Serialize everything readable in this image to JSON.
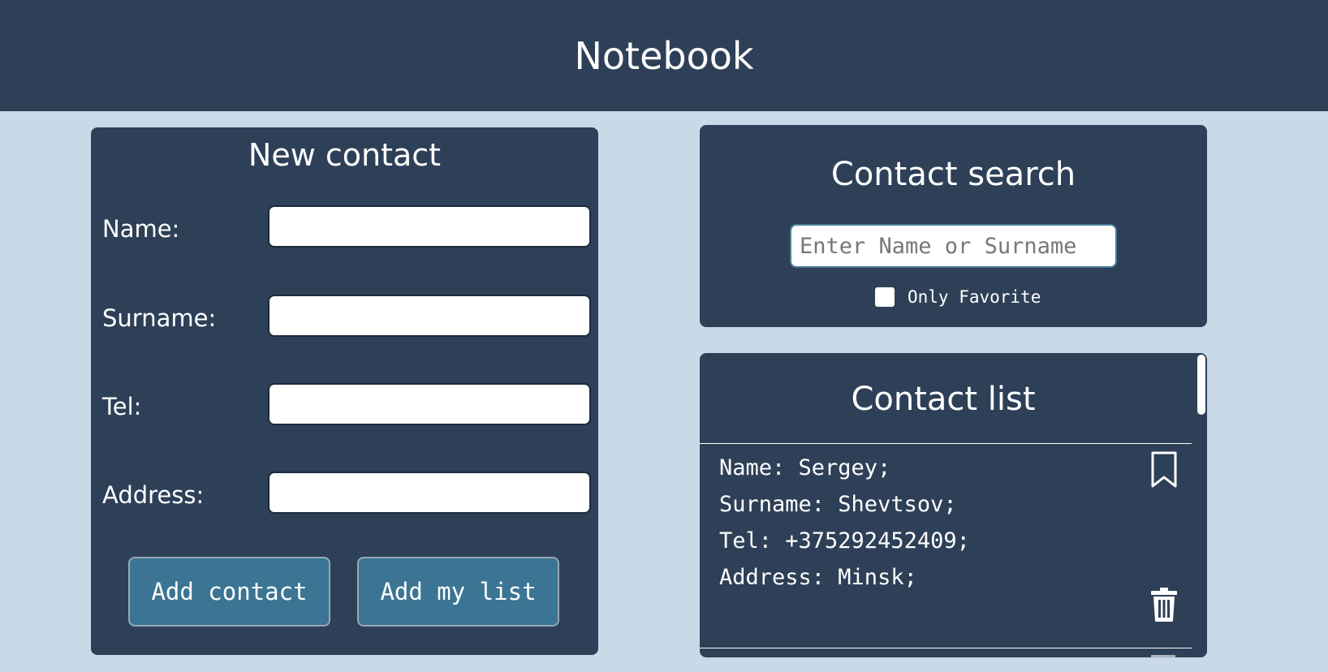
{
  "app": {
    "title": "Notebook"
  },
  "new_contact": {
    "title": "New contact",
    "fields": [
      {
        "label": "Name:",
        "value": ""
      },
      {
        "label": "Surname:",
        "value": ""
      },
      {
        "label": "Tel:",
        "value": ""
      },
      {
        "label": "Address:",
        "value": ""
      }
    ],
    "add_contact_label": "Add contact",
    "add_my_list_label": "Add my list"
  },
  "search": {
    "title": "Contact search",
    "placeholder": "Enter Name or Surname",
    "value": "",
    "only_favorite_label": "Only Favorite",
    "only_favorite_checked": false
  },
  "contact_list": {
    "title": "Contact list",
    "items": [
      {
        "name_line": "Name: Sergey;",
        "surname_line": "Surname: Shevtsov;",
        "tel_line": "Tel: +375292452409;",
        "address_line": "Address: Minsk;",
        "icons": {
          "favorite": "bookmark-icon",
          "delete": "trash-icon"
        }
      }
    ]
  },
  "colors": {
    "background": "#c8d9e7",
    "panel": "#2e4057",
    "button": "#3b7593",
    "text": "#ffffff"
  }
}
